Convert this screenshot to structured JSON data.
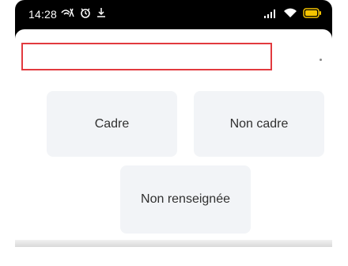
{
  "status_bar": {
    "time": "14:28",
    "left_icons": [
      "wifi-calling-icon",
      "alarm-icon",
      "download-icon"
    ],
    "right_icons": [
      "signal-icon",
      "wifi-icon",
      "battery-icon"
    ]
  },
  "form": {
    "field_value": ""
  },
  "choices": [
    {
      "label": "Cadre"
    },
    {
      "label": "Non cadre"
    },
    {
      "label": "Non renseignée"
    }
  ],
  "colors": {
    "field_border": "#e23a3f",
    "choice_background": "#f2f4f7"
  }
}
